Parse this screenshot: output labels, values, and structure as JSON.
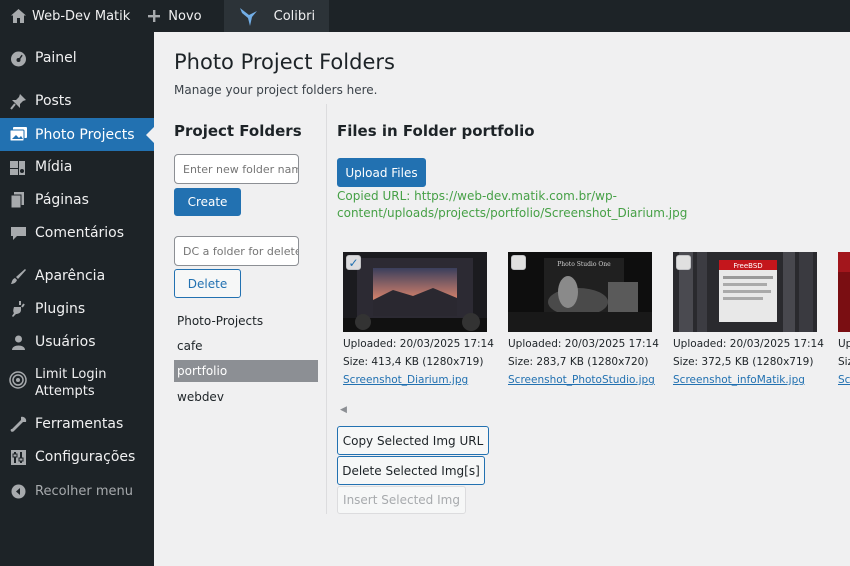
{
  "adminbar": {
    "site_name": "Web-Dev Matik",
    "new_label": "Novo",
    "colibri_label": "Colibri"
  },
  "sidebar": {
    "items": [
      {
        "label": "Painel",
        "icon": "dashboard-icon"
      },
      {
        "label": "Posts",
        "icon": "pin-icon"
      },
      {
        "label": "Photo Projects",
        "icon": "images-icon",
        "current": true
      },
      {
        "label": "Mídia",
        "icon": "media-icon"
      },
      {
        "label": "Páginas",
        "icon": "pages-icon"
      },
      {
        "label": "Comentários",
        "icon": "comment-icon"
      },
      {
        "label": "Aparência",
        "icon": "brush-icon"
      },
      {
        "label": "Plugins",
        "icon": "plugin-icon"
      },
      {
        "label": "Usuários",
        "icon": "user-icon"
      },
      {
        "label": "Limit Login Attempts",
        "icon": "shield-icon"
      },
      {
        "label": "Ferramentas",
        "icon": "wrench-icon"
      },
      {
        "label": "Configurações",
        "icon": "settings-icon"
      },
      {
        "label": "Recolher menu",
        "icon": "collapse-icon"
      }
    ]
  },
  "page": {
    "title": "Photo Project Folders",
    "subtitle": "Manage your project folders here."
  },
  "folders": {
    "title": "Project Folders",
    "new_folder_placeholder": "Enter new folder name",
    "create_label": "Create",
    "delete_placeholder": "DC a folder for delete",
    "delete_label": "Delete",
    "list": [
      "Photo-Projects",
      "cafe",
      "portfolio",
      "webdev"
    ],
    "active": "portfolio"
  },
  "files": {
    "title": "Files in Folder portfolio",
    "upload_label": "Upload Files",
    "copied_url": "Copied URL: https://web-dev.matik.com.br/wp-content/uploads/projects/portfolio/Screenshot_Diarium.jpg",
    "items": [
      {
        "uploaded": "Uploaded: 20/03/2025 17:14",
        "size": "Size: 413,4 KB (1280x719)",
        "name": "Screenshot_Diarium.jpg",
        "checked": true
      },
      {
        "uploaded": "Uploaded: 20/03/2025 17:14",
        "size": "Size: 283,7 KB (1280x720)",
        "name": "Screenshot_PhotoStudio.jpg",
        "checked": false
      },
      {
        "uploaded": "Uploaded: 20/03/2025 17:14",
        "size": "Size: 372,5 KB (1280x719)",
        "name": "Screenshot_infoMatik.jpg",
        "checked": false
      },
      {
        "uploaded": "Up",
        "size": "Siz",
        "name": "Sc",
        "checked": false
      }
    ],
    "thumb_texts": {
      "photostudio": "Photo Studio One",
      "freebsd": "FreeBSD"
    },
    "copy_label": "Copy Selected Img URL",
    "delete_label": "Delete Selected Img[s]",
    "insert_label": "Insert Selected Img"
  },
  "colors": {
    "accent": "#2271b1",
    "adminbar": "#1d2327",
    "success": "#46a046"
  }
}
